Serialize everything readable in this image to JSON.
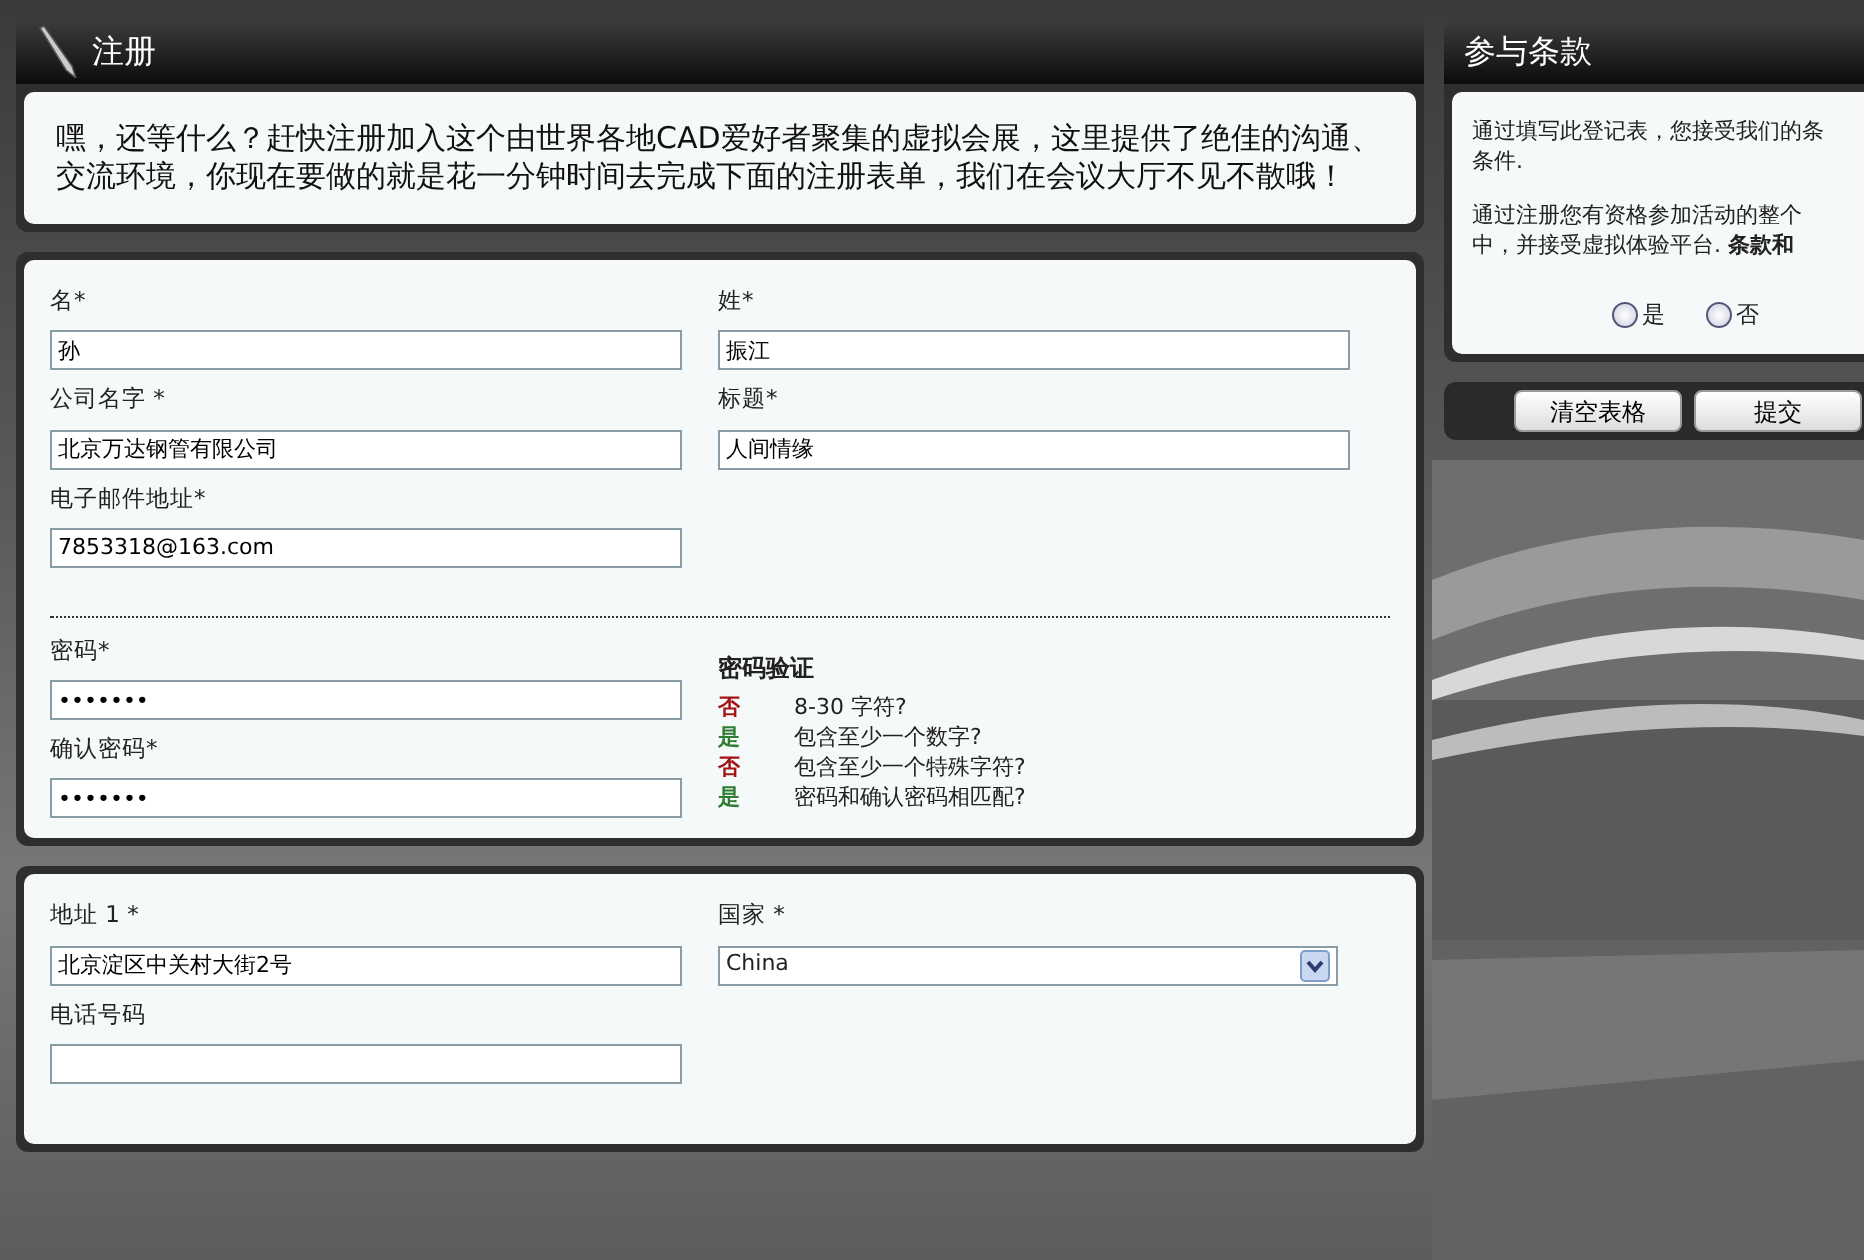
{
  "registration": {
    "title": "注册",
    "intro": "嘿，还等什么？赶快注册加入这个由世界各地CAD爱好者聚集的虚拟会展，这里提供了绝佳的沟通、交流环境，你现在要做的就是花一分钟时间去完成下面的注册表单，我们在会议大厅不见不散哦！"
  },
  "account": {
    "fields": [
      {
        "label": "名*",
        "value": "孙"
      },
      {
        "label": "姓*",
        "value": "振江"
      },
      {
        "label": "公司名字 *",
        "value": "北京万达钢管有限公司"
      },
      {
        "label": "标题*",
        "value": "人间情缘"
      },
      {
        "label": "电子邮件地址*",
        "value": "7853318@163.com"
      }
    ]
  },
  "password": {
    "fields": [
      {
        "label": "密码*",
        "value": "•••••••"
      },
      {
        "label": "确认密码*",
        "value": "•••••••"
      }
    ],
    "checks": {
      "title": "密码验证",
      "items": [
        {
          "passed": false,
          "result": "否",
          "text": "8-30 字符?"
        },
        {
          "passed": true,
          "result": "是",
          "text": "包含至少一个数字?"
        },
        {
          "passed": false,
          "result": "否",
          "text": "包含至少一个特殊字符?"
        },
        {
          "passed": true,
          "result": "是",
          "text": "密码和确认密码相匹配?"
        }
      ]
    }
  },
  "address": {
    "fields": [
      {
        "label": "地址 1 *",
        "value": "北京淀区中关村大街2号",
        "kind": "text"
      },
      {
        "label": "国家 *",
        "value": "China",
        "kind": "select"
      },
      {
        "label": "电话号码",
        "kind": "text"
      }
    ]
  },
  "terms": {
    "title": "参与条款",
    "paragraphs": [
      [
        "通过填写此登记表，您接受我们的条",
        "条件."
      ],
      [
        "通过注册您有资格参加活动的整个",
        "中，并接受虚拟体验平台. **条款和**"
      ]
    ],
    "options": [
      {
        "label": "是",
        "selected": false
      },
      {
        "label": "否",
        "selected": false
      }
    ]
  },
  "buttons": [
    "清空表格",
    "提交"
  ]
}
